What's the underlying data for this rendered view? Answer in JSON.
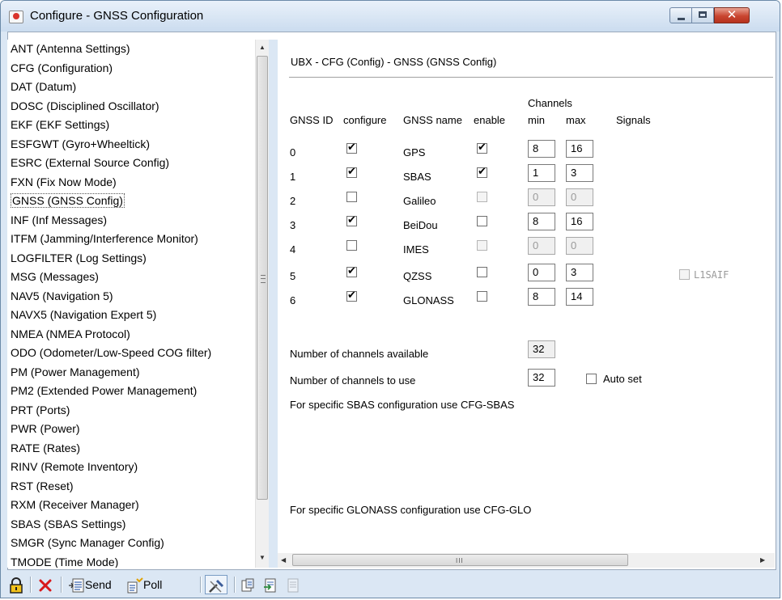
{
  "window": {
    "title": "Configure - GNSS Configuration"
  },
  "list": {
    "items": [
      "ANT (Antenna Settings)",
      "CFG (Configuration)",
      "DAT (Datum)",
      "DOSC (Disciplined Oscillator)",
      "EKF (EKF Settings)",
      "ESFGWT (Gyro+Wheeltick)",
      "ESRC (External Source Config)",
      "FXN (Fix Now Mode)",
      "GNSS (GNSS Config)",
      "INF (Inf Messages)",
      "ITFM (Jamming/Interference Monitor)",
      "LOGFILTER (Log Settings)",
      "MSG (Messages)",
      "NAV5 (Navigation 5)",
      "NAVX5 (Navigation Expert 5)",
      "NMEA (NMEA Protocol)",
      "ODO (Odometer/Low-Speed COG filter)",
      "PM (Power Management)",
      "PM2 (Extended Power Management)",
      "PRT (Ports)",
      "PWR (Power)",
      "RATE (Rates)",
      "RINV (Remote Inventory)",
      "RST (Reset)",
      "RXM (Receiver Manager)",
      "SBAS (SBAS Settings)",
      "SMGR (Sync Manager Config)",
      "TMODE (Time Mode)"
    ],
    "selected": "GNSS (GNSS Config)"
  },
  "panel": {
    "title": "UBX - CFG (Config) - GNSS (GNSS Config)",
    "headers": {
      "channels": "Channels",
      "gnss_id": "GNSS ID",
      "configure": "configure",
      "gnss_name": "GNSS name",
      "enable": "enable",
      "min": "min",
      "max": "max",
      "signals": "Signals"
    },
    "rows": [
      {
        "id": "0",
        "configure": true,
        "name": "GPS",
        "enable": true,
        "enable_disabled": false,
        "min": "8",
        "max": "16",
        "fields_disabled": false
      },
      {
        "id": "1",
        "configure": true,
        "name": "SBAS",
        "enable": true,
        "enable_disabled": false,
        "min": "1",
        "max": "3",
        "fields_disabled": false
      },
      {
        "id": "2",
        "configure": false,
        "name": "Galileo",
        "enable": false,
        "enable_disabled": true,
        "min": "0",
        "max": "0",
        "fields_disabled": true
      },
      {
        "id": "3",
        "configure": true,
        "name": "BeiDou",
        "enable": false,
        "enable_disabled": false,
        "min": "8",
        "max": "16",
        "fields_disabled": false
      },
      {
        "id": "4",
        "configure": false,
        "name": "IMES",
        "enable": false,
        "enable_disabled": true,
        "min": "0",
        "max": "0",
        "fields_disabled": true
      },
      {
        "id": "5",
        "configure": true,
        "name": "QZSS",
        "enable": false,
        "enable_disabled": false,
        "min": "0",
        "max": "3",
        "fields_disabled": false
      },
      {
        "id": "6",
        "configure": true,
        "name": "GLONASS",
        "enable": false,
        "enable_disabled": false,
        "min": "8",
        "max": "14",
        "fields_disabled": false
      }
    ],
    "qzss_signal": {
      "label": "L1SAIF",
      "checked": false
    },
    "channels_available": {
      "label": "Number of channels available",
      "value": "32"
    },
    "channels_to_use": {
      "label": "Number of channels to use",
      "value": "32"
    },
    "auto_set": {
      "label": "Auto set",
      "checked": false
    },
    "sbas_note": "For specific SBAS configuration use CFG-SBAS",
    "glonass_note": "For specific GLONASS configuration use CFG-GLO"
  },
  "toolbar": {
    "send": "Send",
    "poll": "Poll"
  },
  "hscroll_grip": "III"
}
